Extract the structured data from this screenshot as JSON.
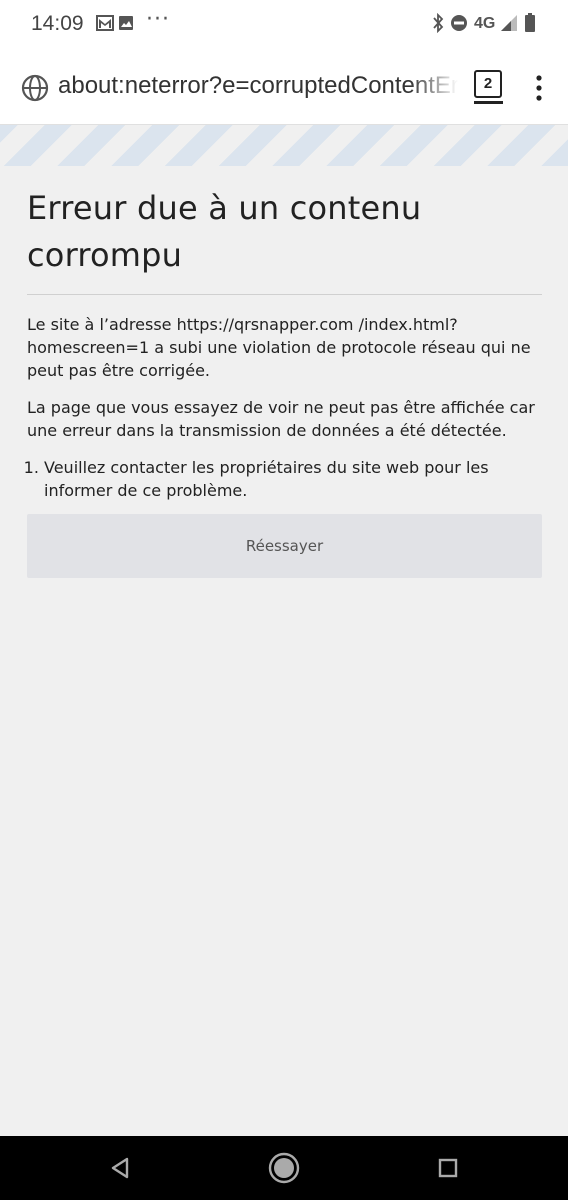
{
  "status_bar": {
    "time": "14:09",
    "left_icons": [
      "gmail-icon",
      "image-icon"
    ],
    "overflow": "···",
    "network": "4G",
    "right_icons": [
      "bluetooth-icon",
      "do-not-disturb-icon",
      "signal-icon",
      "battery-icon"
    ]
  },
  "url_bar": {
    "url": "about:neterror?e=corruptedContentError",
    "tab_count": "2",
    "icons": [
      "globe-icon",
      "tab-counter-icon",
      "menu-icon"
    ]
  },
  "error_page": {
    "title": "Erreur due à un contenu corrompu",
    "paragraph_1": "Le site à l’adresse https://qrsnapper.com /index.html?homescreen=1 a subi une violation de protocole réseau qui ne peut pas être corrigée.",
    "paragraph_2": "La page que vous essayez de voir ne peut pas être affichée car une erreur dans la transmission de données a été détectée.",
    "steps": [
      "Veuillez contacter les propriétaires du site web pour les informer de ce problème."
    ],
    "retry_label": "Réessayer"
  },
  "nav_bar": {
    "icons": [
      "back-icon",
      "home-icon",
      "recents-icon"
    ]
  },
  "colors": {
    "page_background": "#f0f0f0",
    "stripe": "#dbe4ee",
    "button_background": "#e1e2e6",
    "nav_background": "#000000"
  }
}
